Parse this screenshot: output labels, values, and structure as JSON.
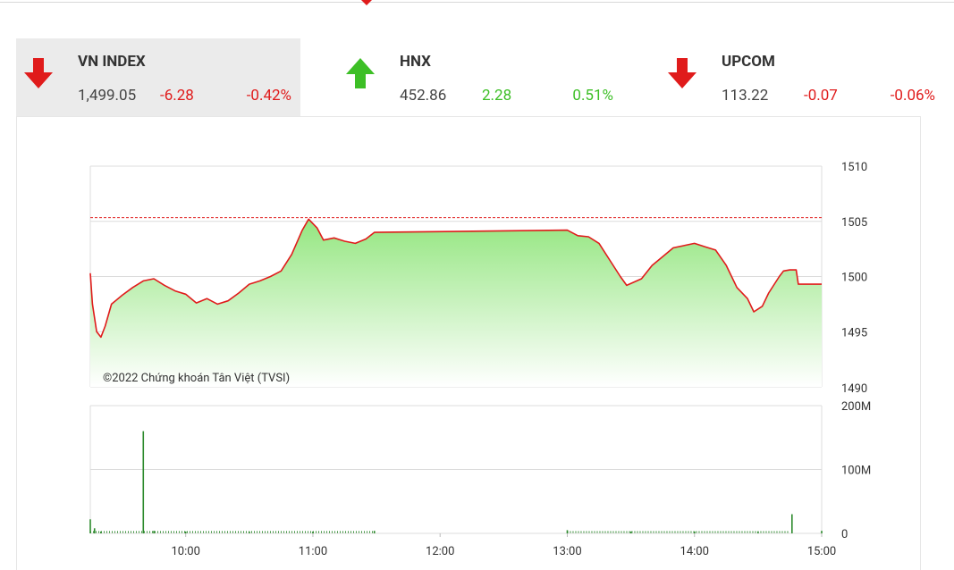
{
  "indices": [
    {
      "name": "VN INDEX",
      "value": "1,499.05",
      "change": "-6.28",
      "percent": "-0.42%",
      "direction": "down",
      "active": true
    },
    {
      "name": "HNX",
      "value": "452.86",
      "change": "2.28",
      "percent": "0.51%",
      "direction": "up",
      "active": false
    },
    {
      "name": "UPCOM",
      "value": "113.22",
      "change": "-0.07",
      "percent": "-0.06%",
      "direction": "down",
      "active": false
    }
  ],
  "colors": {
    "up": "#3dbf26",
    "down": "#e01b1b",
    "line": "#e01b1b",
    "area_top": "#94e680",
    "volume": "#2e8b2e",
    "reference": "#e01b1b"
  },
  "chart_data": [
    {
      "type": "area",
      "title": "",
      "watermark": "©2022 Chứng khoán Tân Việt (TVSI)",
      "ylim": [
        1490,
        1510
      ],
      "yticks": [
        1510,
        1505,
        1500,
        1495,
        1490
      ],
      "reference": 1505.33,
      "x_start": "09:15",
      "x_end": "15:00",
      "xticks": [
        "10:00",
        "11:00",
        "12:00",
        "13:00",
        "14:00",
        "15:00"
      ],
      "points": [
        [
          "09:15",
          1500.3
        ],
        [
          "09:16",
          1497.5
        ],
        [
          "09:18",
          1495.0
        ],
        [
          "09:20",
          1494.5
        ],
        [
          "09:22",
          1495.5
        ],
        [
          "09:25",
          1497.5
        ],
        [
          "09:30",
          1498.3
        ],
        [
          "09:35",
          1499.0
        ],
        [
          "09:40",
          1499.6
        ],
        [
          "09:45",
          1499.8
        ],
        [
          "09:50",
          1499.2
        ],
        [
          "09:55",
          1498.7
        ],
        [
          "10:00",
          1498.4
        ],
        [
          "10:05",
          1497.6
        ],
        [
          "10:10",
          1498.0
        ],
        [
          "10:15",
          1497.5
        ],
        [
          "10:20",
          1497.8
        ],
        [
          "10:25",
          1498.5
        ],
        [
          "10:30",
          1499.3
        ],
        [
          "10:35",
          1499.6
        ],
        [
          "10:40",
          1500.0
        ],
        [
          "10:45",
          1500.5
        ],
        [
          "10:50",
          1502.0
        ],
        [
          "10:55",
          1504.2
        ],
        [
          "10:58",
          1505.2
        ],
        [
          "11:02",
          1504.4
        ],
        [
          "11:05",
          1503.3
        ],
        [
          "11:10",
          1503.5
        ],
        [
          "11:15",
          1503.2
        ],
        [
          "11:20",
          1503.0
        ],
        [
          "11:25",
          1503.4
        ],
        [
          "11:29",
          1504.0
        ],
        [
          "13:00",
          1504.2
        ],
        [
          "13:05",
          1503.7
        ],
        [
          "13:10",
          1503.6
        ],
        [
          "13:15",
          1503.0
        ],
        [
          "13:20",
          1501.5
        ],
        [
          "13:25",
          1500.0
        ],
        [
          "13:28",
          1499.2
        ],
        [
          "13:35",
          1499.8
        ],
        [
          "13:40",
          1501.0
        ],
        [
          "13:45",
          1501.8
        ],
        [
          "13:50",
          1502.6
        ],
        [
          "13:55",
          1502.8
        ],
        [
          "14:00",
          1503.0
        ],
        [
          "14:05",
          1502.7
        ],
        [
          "14:10",
          1502.4
        ],
        [
          "14:15",
          1501.0
        ],
        [
          "14:20",
          1499.0
        ],
        [
          "14:25",
          1498.0
        ],
        [
          "14:28",
          1496.8
        ],
        [
          "14:32",
          1497.3
        ],
        [
          "14:35",
          1498.5
        ],
        [
          "14:40",
          1500.0
        ],
        [
          "14:42",
          1500.5
        ],
        [
          "14:45",
          1500.6
        ],
        [
          "14:48",
          1500.6
        ],
        [
          "14:49",
          1499.3
        ],
        [
          "15:00",
          1499.3
        ]
      ]
    },
    {
      "type": "bar",
      "title": "",
      "ylim": [
        0,
        200
      ],
      "yticks": [
        "200M",
        "100M",
        "0"
      ],
      "unit": "M",
      "bars": [
        [
          "09:15",
          22
        ],
        [
          "09:17",
          8
        ],
        [
          "09:20",
          3
        ],
        [
          "09:40",
          160
        ],
        [
          "09:45",
          4
        ],
        [
          "10:00",
          3
        ],
        [
          "10:30",
          3
        ],
        [
          "11:00",
          3
        ],
        [
          "11:29",
          4
        ],
        [
          "13:00",
          5
        ],
        [
          "13:30",
          3
        ],
        [
          "14:00",
          3
        ],
        [
          "14:30",
          3
        ],
        [
          "14:46",
          30
        ],
        [
          "15:00",
          4
        ]
      ]
    }
  ]
}
